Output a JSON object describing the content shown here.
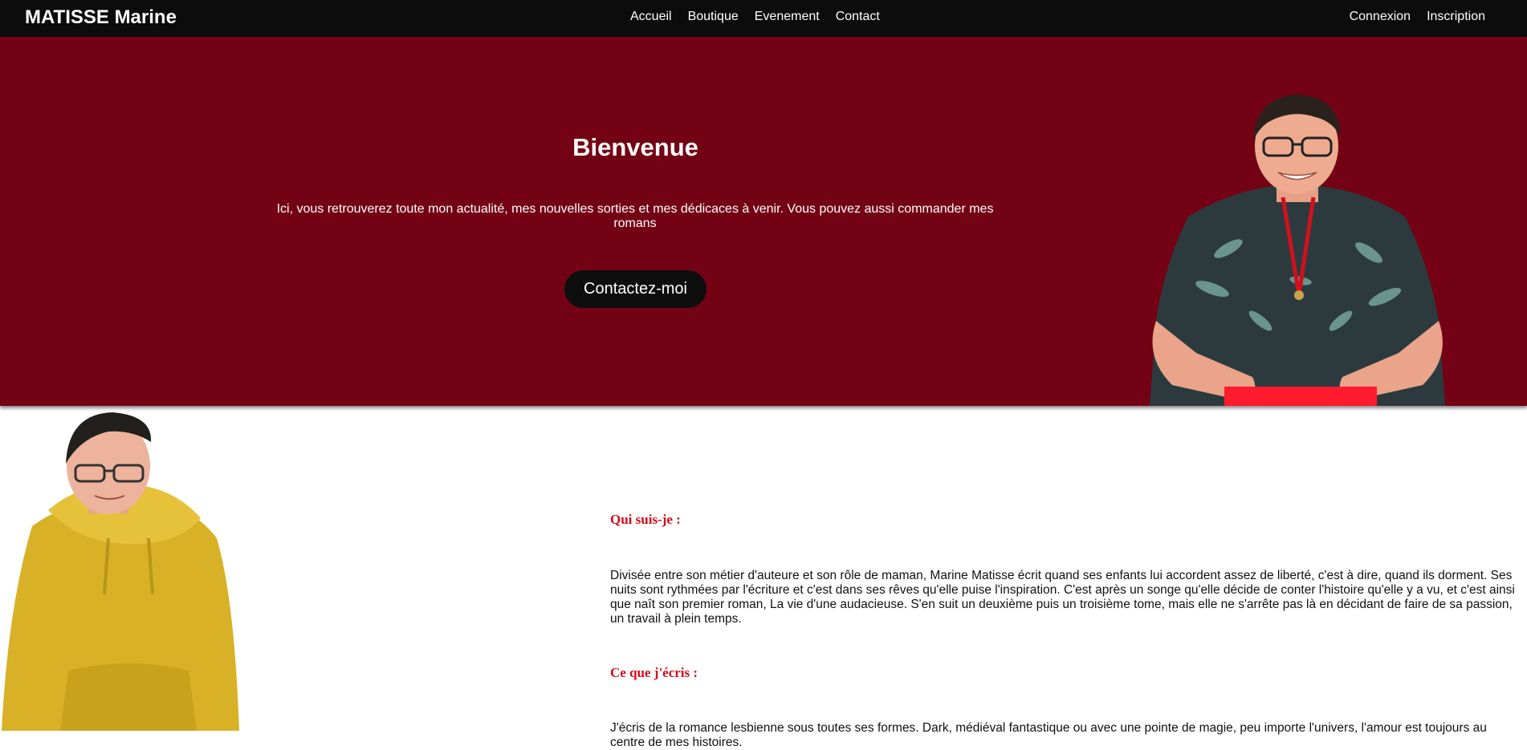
{
  "nav": {
    "brand": "MATISSE Marine",
    "links": [
      "Accueil",
      "Boutique",
      "Evenement",
      "Contact"
    ],
    "auth": [
      "Connexion",
      "Inscription"
    ]
  },
  "hero": {
    "title": "Bienvenue",
    "text": "Ici, vous retrouverez toute mon actualité, mes nouvelles sorties et mes dédicaces à venir. Vous pouvez aussi commander mes romans",
    "button": "Contactez-moi",
    "background_color": "#740215"
  },
  "about": {
    "heading1": "Qui suis-je :",
    "paragraph1": "Divisée entre son métier d'auteure et son rôle de maman, Marine Matisse écrit quand ses enfants lui accordent assez de liberté, c'est à dire, quand ils dorment. Ses nuits sont rythmées par l'écriture et c'est dans ses rêves qu'elle puise l'inspiration. C'est après un songe qu'elle décide de conter l'histoire qu'elle y a vu, et c'est ainsi que naît son premier roman, La vie d'une audacieuse. S'en suit un deuxième puis un troisième tome, mais elle ne s'arrête pas là en décidant de faire de sa passion, un travail à plein temps.",
    "heading2": "Ce que j'écris :",
    "paragraph2": "J'écris de la romance lesbienne sous toutes ses formes. Dark, médiéval fantastique ou avec une pointe de magie, peu importe l'univers, l'amour est toujours au centre de mes histoires.",
    "heading_color": "#d40d1a"
  }
}
